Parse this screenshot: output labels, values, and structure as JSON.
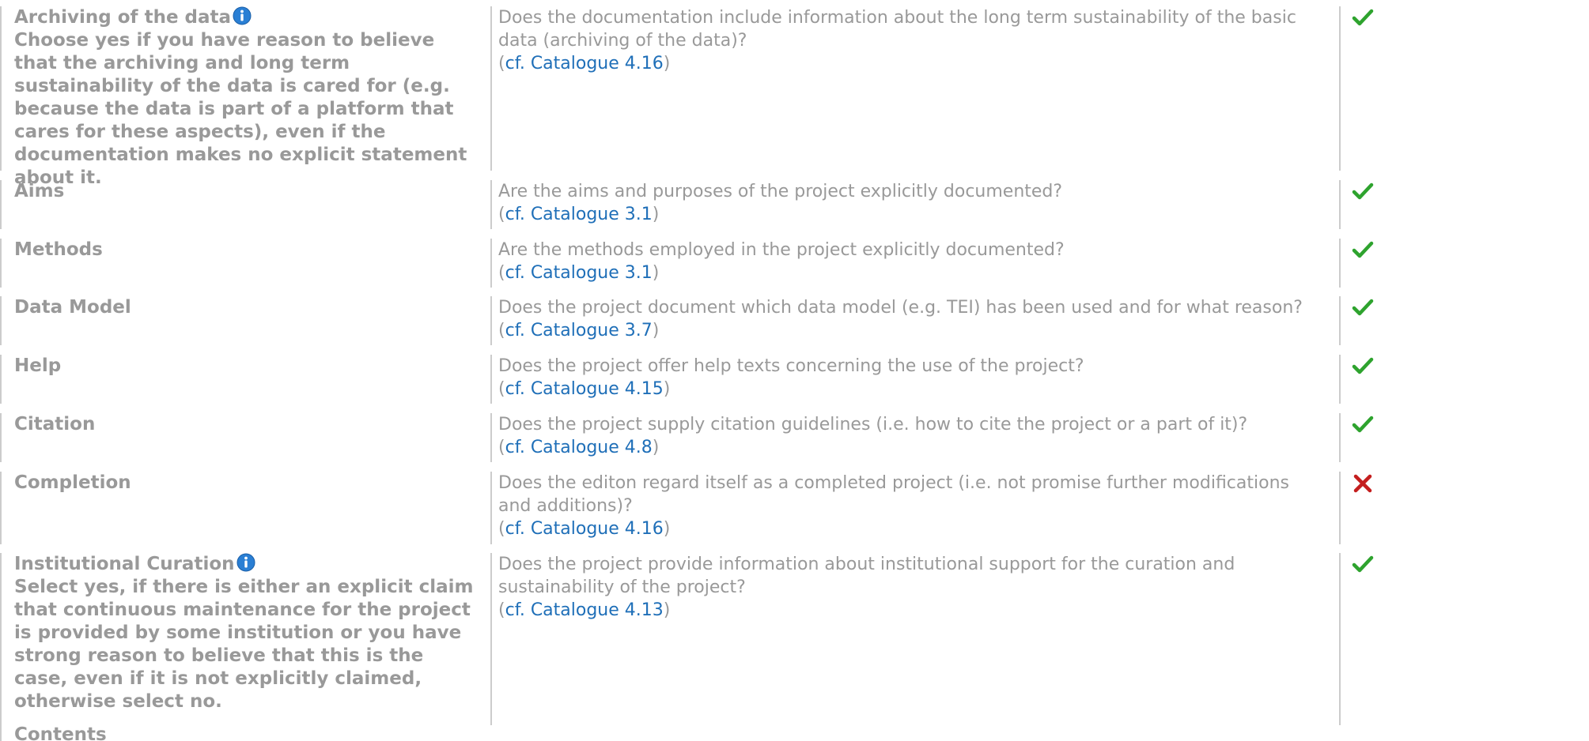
{
  "rows": [
    {
      "label": "Archiving of the data",
      "explanation": "Choose yes if you have reason to believe that the archiving and long term sustainability of the data is cared for (e.g. because the data is part of a platform that cares for these aspects), even if the documentation makes no explicit statement about it.",
      "question": "Does the documentation include information about the long term sustainability of the basic data (archiving of the data)?",
      "ref_open": "(",
      "ref_link": "cf. Catalogue 4.16",
      "ref_close": ")",
      "status": "yes",
      "status_icon": "check-icon"
    },
    {
      "label": "Aims",
      "question": "Are the aims and purposes of the project explicitly documented?",
      "ref_open": "(",
      "ref_link": "cf. Catalogue 3.1",
      "ref_close": ")",
      "status": "yes",
      "status_icon": "check-icon"
    },
    {
      "label": "Methods",
      "question": "Are the methods employed in the project explicitly documented?",
      "ref_open": "(",
      "ref_link": "cf. Catalogue 3.1",
      "ref_close": ")",
      "status": "yes",
      "status_icon": "check-icon"
    },
    {
      "label": "Data Model",
      "question": "Does the project document which data model (e.g. TEI) has been used and for what reason?",
      "ref_open": "(",
      "ref_link": "cf. Catalogue 3.7",
      "ref_close": ")",
      "status": "yes",
      "status_icon": "check-icon"
    },
    {
      "label": "Help",
      "question": "Does the project offer help texts concerning the use of the project?",
      "ref_open": "(",
      "ref_link": "cf. Catalogue 4.15",
      "ref_close": ")",
      "status": "yes",
      "status_icon": "check-icon"
    },
    {
      "label": "Citation",
      "question": "Does the project supply citation guidelines (i.e. how to cite the project or a part of it)?",
      "ref_open": "(",
      "ref_link": "cf. Catalogue 4.8",
      "ref_close": ")",
      "status": "yes",
      "status_icon": "check-icon"
    },
    {
      "label": "Completion",
      "question": "Does the editon regard itself as a completed project (i.e. not promise further modifications and additions)?",
      "ref_open": "(",
      "ref_link": "cf. Catalogue 4.16",
      "ref_close": ")",
      "status": "no",
      "status_icon": "cross-icon"
    },
    {
      "label": "Institutional Curation",
      "explanation": "Select yes, if there is either an explicit claim that continuous maintenance for the project is provided by some institution or you have strong reason to believe that this is the case, even if it is not explicitly claimed, otherwise select no.",
      "question": "Does the project provide information about institutional support for the curation and sustainability of the project?",
      "ref_open": "(",
      "ref_link": "cf. Catalogue 4.13",
      "ref_close": ")",
      "status": "yes",
      "status_icon": "check-icon"
    }
  ],
  "section_heading": "Contents",
  "colors": {
    "text": "#999999",
    "link": "#1f6fb8",
    "check": "#2ea32e",
    "cross": "#c41e1e",
    "info": "#2a7fd4",
    "divider": "#cccccc"
  }
}
